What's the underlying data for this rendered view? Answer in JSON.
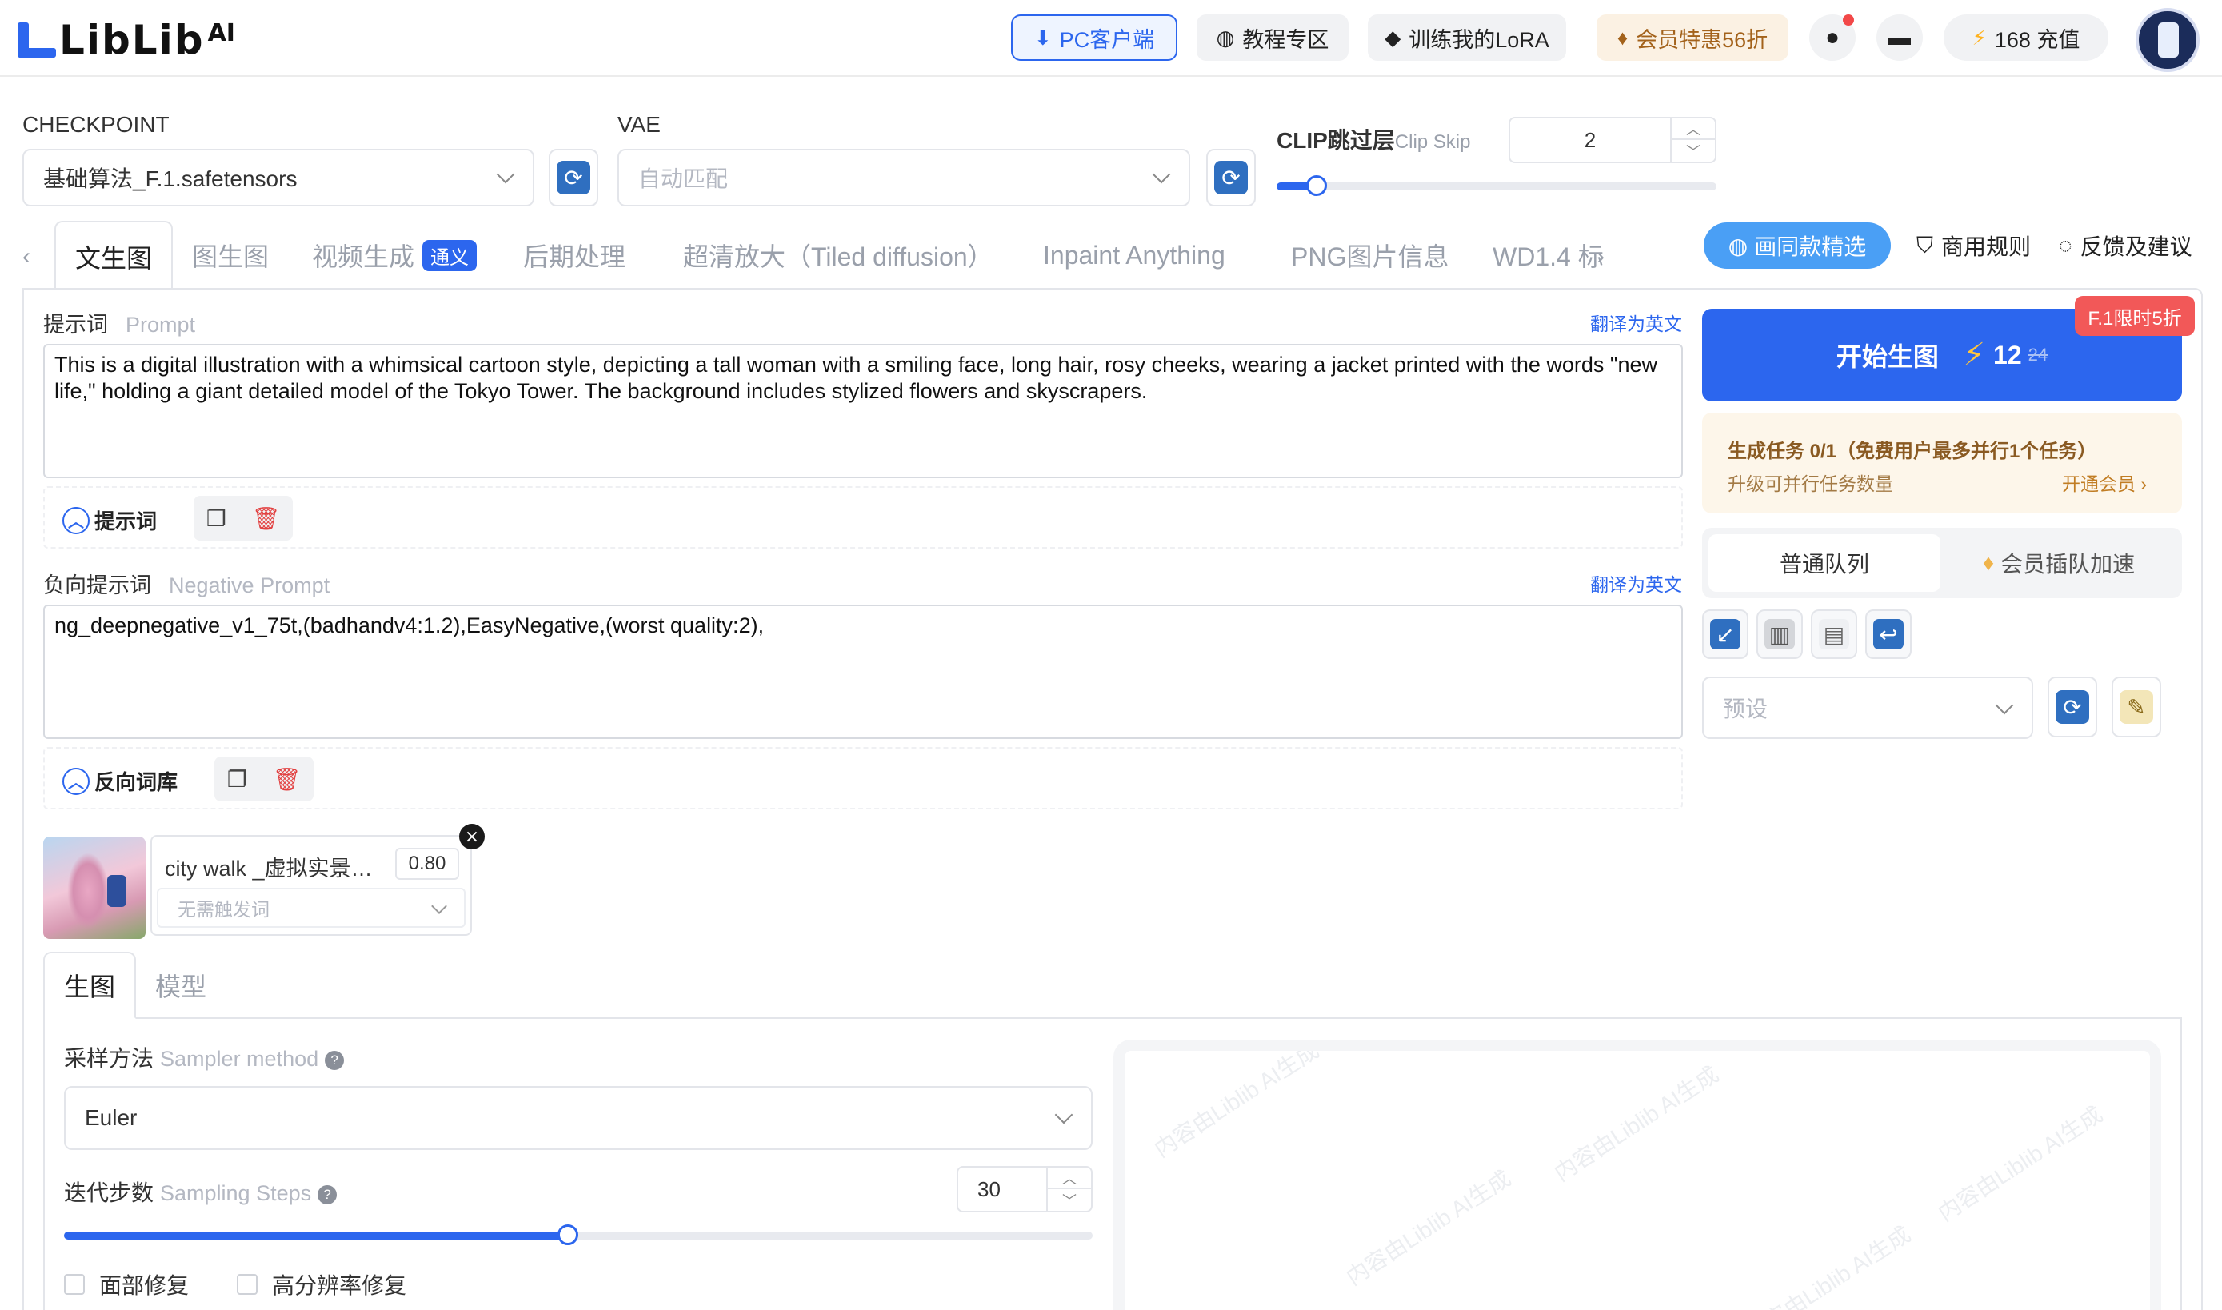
{
  "header": {
    "logo_text": "LibLib",
    "logo_ai": "AI",
    "pc_client": "PC客户端",
    "tutorial": "教程专区",
    "train_lora": "训练我的LoRA",
    "vip_offer": "会员特惠56折",
    "recharge": "168 充值"
  },
  "settings": {
    "checkpoint_label": "CHECKPOINT",
    "checkpoint_value": "基础算法_F.1.safetensors",
    "vae_label": "VAE",
    "vae_value": "自动匹配",
    "clip_label": "CLIP跳过层",
    "clip_sub": "Clip Skip",
    "clip_value": "2",
    "clip_fraction": 0.09
  },
  "tabs": [
    {
      "label": "文生图",
      "active": true
    },
    {
      "label": "图生图"
    },
    {
      "label": "视频生成",
      "badge": "通义"
    },
    {
      "label": "后期处理"
    },
    {
      "label": "超清放大（Tiled diffusion）"
    },
    {
      "label": "Inpaint Anything"
    },
    {
      "label": "PNG图片信息"
    },
    {
      "label": "WD1.4 标"
    }
  ],
  "tab_actions": {
    "same_style": "画同款精选",
    "commercial": "商用规则",
    "feedback": "反馈及建议"
  },
  "prompt": {
    "label": "提示词",
    "label_en": "Prompt",
    "translate": "翻译为英文",
    "text": "This is a digital illustration with a whimsical cartoon style, depicting a tall woman with a smiling face, long hair, rosy cheeks, wearing a jacket printed with the words \"new life,\" holding a giant detailed model of the Tokyo Tower. The background includes stylized flowers and skyscrapers.",
    "expand_label": "提示词"
  },
  "negative": {
    "label": "负向提示词",
    "label_en": "Negative Prompt",
    "translate": "翻译为英文",
    "text": "ng_deepnegative_v1_75t,(badhandv4:1.2),EasyNegative,(worst quality:2),",
    "expand_label": "反向词库"
  },
  "lora": {
    "name": "city walk _虚拟实景…",
    "weight": "0.80",
    "trigger_placeholder": "无需触发词"
  },
  "subtabs": [
    "生图",
    "模型"
  ],
  "sampler": {
    "label": "采样方法",
    "label_en": "Sampler method",
    "value": "Euler"
  },
  "steps": {
    "label": "迭代步数",
    "label_en": "Sampling Steps",
    "value": "30",
    "fraction": 0.49
  },
  "checkboxes": [
    "面部修复",
    "高分辨率修复"
  ],
  "generate": {
    "label": "开始生图",
    "cost": "12",
    "old_cost": "24",
    "promo": "F.1限时5折"
  },
  "task": {
    "title": "生成任务 0/1（免费用户最多并行1个任务）",
    "sub": "升级可并行任务数量",
    "link": "开通会员 ›"
  },
  "queue": {
    "normal": "普通队列",
    "vip": "会员插队加速"
  },
  "preset": {
    "placeholder": "预设"
  },
  "watermark": "内容由Liblib AI生成",
  "colors": {
    "accent": "#2c66ee",
    "promo": "#f25858",
    "vip_bg": "#fbf1e3"
  }
}
